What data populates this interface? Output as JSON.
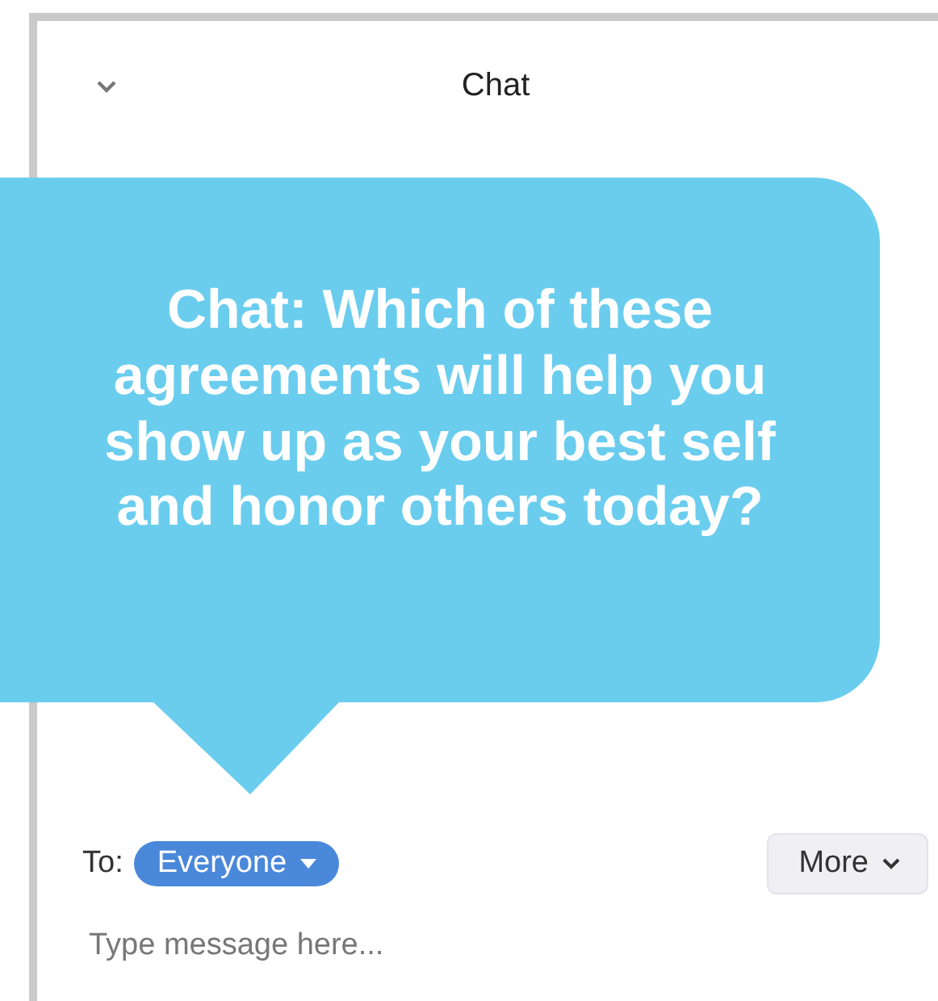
{
  "header": {
    "title": "Chat"
  },
  "callout": {
    "text": "Chat: Which of these agreements will help you show up as your best self and honor others today?"
  },
  "recipient": {
    "label": "To:",
    "value": "Everyone"
  },
  "more_button": {
    "label": "More"
  },
  "message_field": {
    "placeholder": "Type message here..."
  }
}
